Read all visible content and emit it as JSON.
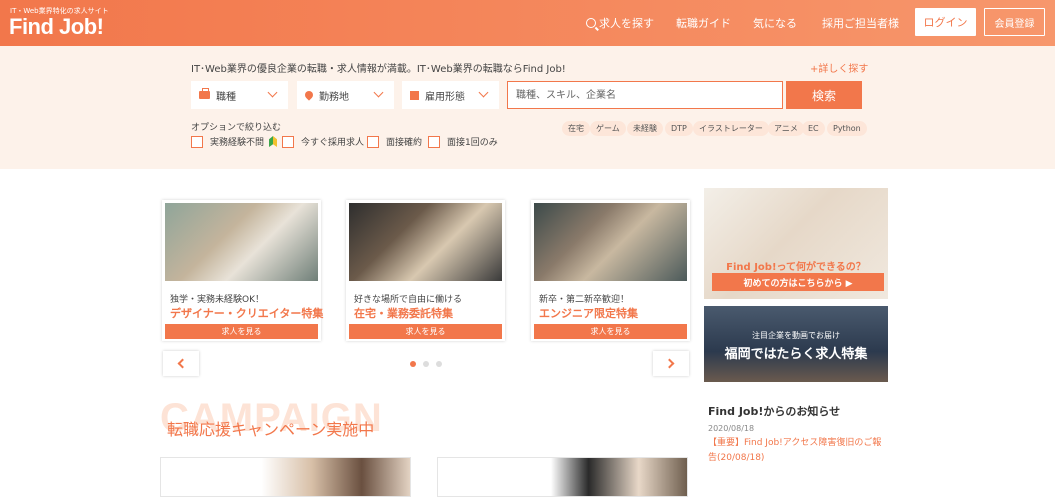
{
  "header": {
    "tagline": "IT・Web業界特化の求人サイト",
    "logo": "Find Job!",
    "nav": {
      "search": "求人を探す",
      "guide": "転職ガイド",
      "favorites": "気になる",
      "recruiter": "採用ご担当者様"
    },
    "login": "ログイン",
    "register": "会員登録"
  },
  "search": {
    "intro": "IT･Web業界の優良企業の転職・求人情報が満載。IT･Web業界の転職ならFind Job!",
    "detail_link": "+詳しく探す",
    "selects": {
      "job_type": "職種",
      "location": "勤務地",
      "employment": "雇用形態"
    },
    "keyword_placeholder": "職種、スキル、企業名",
    "button": "検索",
    "options_title": "オプションで絞り込む",
    "options": [
      "実務経験不問",
      "今すぐ採用求人",
      "面接確約",
      "面接1回のみ"
    ],
    "tags": [
      "在宅",
      "ゲーム",
      "未経験",
      "DTP",
      "イラストレーター",
      "アニメ",
      "EC",
      "Python"
    ]
  },
  "features": [
    {
      "subtitle": "独学・実務未経験OK！",
      "title": "デザイナー・クリエイター特集",
      "cta": "求人を見る"
    },
    {
      "subtitle": "好きな場所で自由に働ける",
      "title": "在宅・業務委託特集",
      "cta": "求人を見る"
    },
    {
      "subtitle": "新卒・第二新卒歓迎！",
      "title": "エンジニア限定特集",
      "cta": "求人を見る"
    }
  ],
  "banners": {
    "about_question": "Find Job!って何ができるの？",
    "about_cta": "初めての方はこちらから ▶",
    "fukuoka_small": "注目企業を動画でお届け",
    "fukuoka_big": "福岡ではたらく求人特集"
  },
  "news": {
    "title": "Find Job!からのお知らせ",
    "date": "2020/08/18",
    "link": "【重要】Find Job!アクセス障害復旧のご報告(20/08/18)"
  },
  "campaign": {
    "bg_text": "CAMPAIGN",
    "title": "転職応援キャンペーン実施中"
  },
  "colors": {
    "accent": "#f2774b",
    "background_light": "#fdf2ea"
  }
}
